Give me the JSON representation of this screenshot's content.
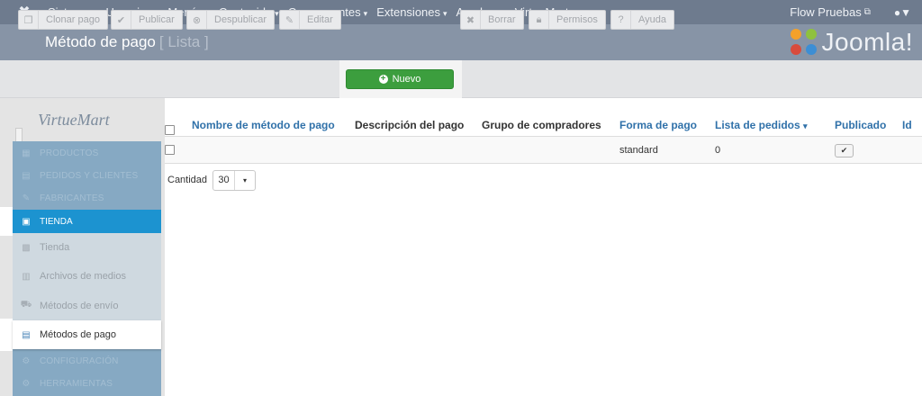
{
  "topbar": {
    "logo_icon": "joomla-icon",
    "menu": [
      {
        "label": "Sistema",
        "caret": "▾"
      },
      {
        "label": "Usuarios",
        "caret": "▾"
      },
      {
        "label": "Menús",
        "caret": "▾"
      },
      {
        "label": "Contenido",
        "caret": "▾"
      },
      {
        "label": "Componentes",
        "caret": "▾"
      },
      {
        "label": "Extensiones",
        "caret": "▾"
      },
      {
        "label": "Ayuda",
        "caret": "▾"
      },
      {
        "label": "VirtueMart",
        "caret": "▾"
      }
    ],
    "site_link": "Flow Pruebas",
    "user_icon": "user-icon"
  },
  "header": {
    "title": "Método de pago",
    "subtitle": "[ Lista ]",
    "brand": "Joomla!"
  },
  "toolbar": {
    "buttons": [
      {
        "label": "Clonar pago",
        "icon": "copy-icon"
      },
      {
        "label": "Publicar",
        "icon": "check-icon"
      },
      {
        "label": "Despublicar",
        "icon": "unpublish-icon"
      },
      {
        "label": "Editar",
        "icon": "edit-icon"
      },
      {
        "label": "Nuevo",
        "icon": "plus-circle-icon",
        "color": "#3c9e3e"
      },
      {
        "label": "Borrar",
        "icon": "delete-icon"
      },
      {
        "label": "Permisos",
        "icon": "lock-icon"
      },
      {
        "label": "Ayuda",
        "icon": "help-icon"
      }
    ]
  },
  "sidebar": {
    "logo": "VirtueMart",
    "items": [
      {
        "label": "PRODUCTOS",
        "icon": "products-icon"
      },
      {
        "label": "PEDIDOS Y CLIENTES",
        "icon": "orders-icon"
      },
      {
        "label": "FABRICANTES",
        "icon": "manufacturers-icon"
      },
      {
        "label": "TIENDA",
        "icon": "shop-icon",
        "active": true
      },
      {
        "label": "Tienda",
        "icon": "store-icon"
      },
      {
        "label": "Archivos de medios",
        "icon": "media-icon"
      },
      {
        "label": "Métodos de envío",
        "icon": "shipment-icon"
      },
      {
        "label": "Métodos de pago",
        "icon": "payment-icon",
        "selected": true
      },
      {
        "label": "CONFIGURACIÓN",
        "icon": "config-icon"
      },
      {
        "label": "HERRAMIENTAS",
        "icon": "tools-icon"
      }
    ],
    "accent_color": "#1c93d0"
  },
  "table": {
    "columns": [
      "Nombre de método de pago",
      "Descripción del pago",
      "Grupo de compradores",
      "Forma de pago",
      "Lista de pedidos",
      "Publicado",
      "Id"
    ],
    "sort_indicator": "▾",
    "rows": [
      {
        "name": "",
        "description": "",
        "shopper_group": "",
        "payment_element": "standard",
        "ordering": "0",
        "published": "✔",
        "id": ""
      }
    ]
  },
  "pagination": {
    "limit_label": "Cantidad",
    "limit_value": "30",
    "limit_arrow": "▾"
  }
}
